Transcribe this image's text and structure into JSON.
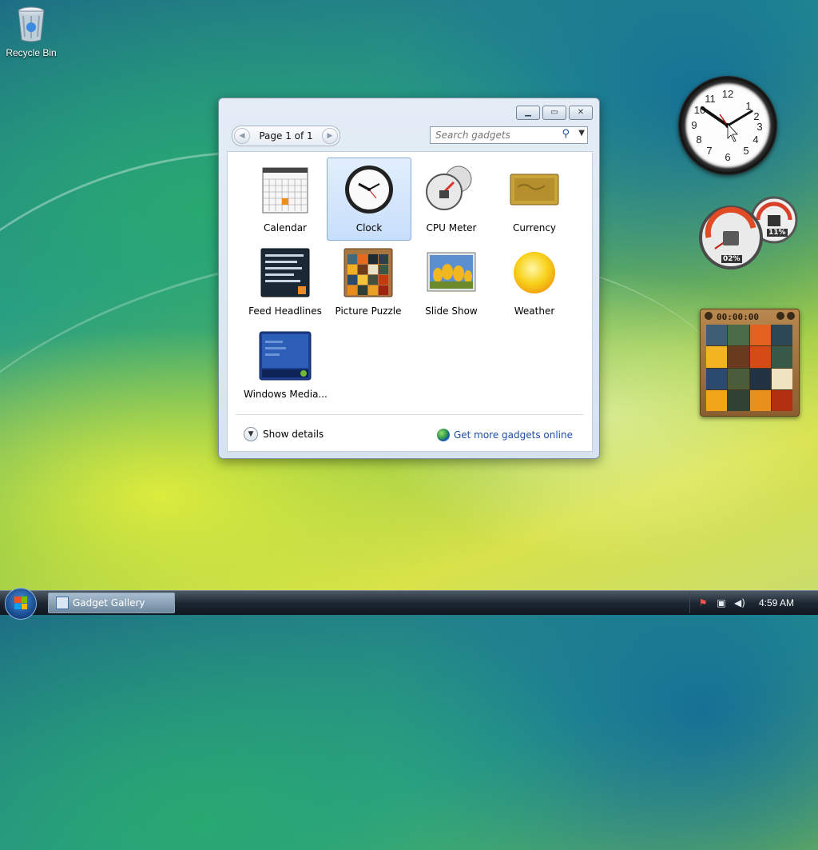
{
  "desktop": {
    "recycle_bin_label": "Recycle Bin"
  },
  "window": {
    "title": "Gadget Gallery",
    "pager": {
      "prev_icon": "chevron-left-icon",
      "label": "Page 1 of 1",
      "next_icon": "chevron-right-icon"
    },
    "search": {
      "placeholder": "Search gadgets"
    },
    "gadgets": [
      {
        "label": "Calendar",
        "icon": "calendar-icon",
        "selected": false
      },
      {
        "label": "Clock",
        "icon": "clock-icon",
        "selected": true
      },
      {
        "label": "CPU Meter",
        "icon": "cpu-meter-icon",
        "selected": false
      },
      {
        "label": "Currency",
        "icon": "currency-icon",
        "selected": false
      },
      {
        "label": "Feed Headlines",
        "icon": "feed-headlines-icon",
        "selected": false
      },
      {
        "label": "Picture Puzzle",
        "icon": "picture-puzzle-icon",
        "selected": false
      },
      {
        "label": "Slide Show",
        "icon": "slide-show-icon",
        "selected": false
      },
      {
        "label": "Weather",
        "icon": "weather-icon",
        "selected": false
      },
      {
        "label": "Windows Media...",
        "icon": "windows-media-icon",
        "selected": false
      }
    ],
    "show_details_label": "Show details",
    "get_more_label": "Get more gadgets online"
  },
  "sidebar_gadgets": {
    "cpu_meter": {
      "cpu_percent": "02%",
      "memory_percent": "11%"
    },
    "puzzle_timer": "00:00:00"
  },
  "taskbar": {
    "task_button_label": "Gadget Gallery",
    "tray_time": "4:59 AM"
  },
  "colors": {
    "accent": "#1c4fa8",
    "selection": "#c7defb",
    "taskbar": "#1d2833"
  }
}
